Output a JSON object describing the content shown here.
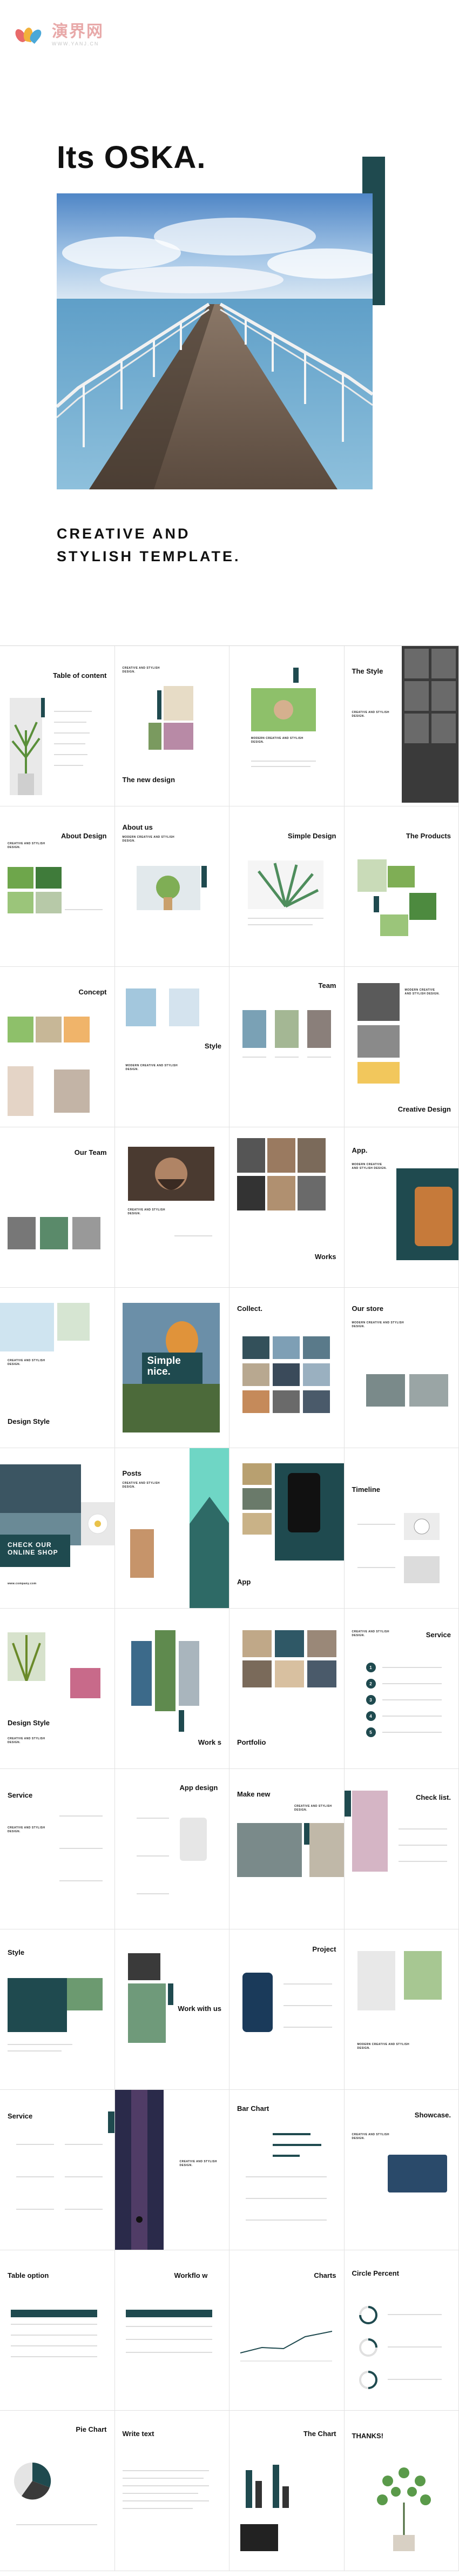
{
  "watermark": {
    "cn": "演界网",
    "en": "WWW.YANJ.CN"
  },
  "cover": {
    "title": "Its OSKA.",
    "subtitle_line1": "CREATIVE AND",
    "subtitle_line2": "STYLISH TEMPLATE."
  },
  "colors": {
    "accent": "#1f4a4f",
    "watermark": "#e8a9a9"
  },
  "slides": [
    {
      "title": "Table of content",
      "align": "right"
    },
    {
      "title": "The new design",
      "align": "left-bottom"
    },
    {
      "title": "",
      "align": "left"
    },
    {
      "title": "The Style",
      "align": "left"
    },
    {
      "title": "About Design",
      "align": "right"
    },
    {
      "title": "About us",
      "align": "left"
    },
    {
      "title": "Simple Design",
      "align": "right"
    },
    {
      "title": "The Products",
      "align": "right"
    },
    {
      "title": "Concept",
      "align": "right"
    },
    {
      "title": "Style",
      "align": "right"
    },
    {
      "title": "Team",
      "align": "right"
    },
    {
      "title": "Creative Design",
      "align": "right-bottom"
    },
    {
      "title": "Our Team",
      "align": "right"
    },
    {
      "title": "",
      "align": "left"
    },
    {
      "title": "Works",
      "align": "right-bottom"
    },
    {
      "title": "App.",
      "align": "left"
    },
    {
      "title": "Design Style",
      "align": "left-bottom"
    },
    {
      "title": "Simple nice.",
      "align": "center"
    },
    {
      "title": "Collect.",
      "align": "left"
    },
    {
      "title": "Our store",
      "align": "left"
    },
    {
      "title": "CHECK OUR ONLINE SHOP",
      "align": "left-bottom"
    },
    {
      "title": "Posts",
      "align": "left"
    },
    {
      "title": "App",
      "align": "left-bottom"
    },
    {
      "title": "Timeline",
      "align": "left"
    },
    {
      "title": "Design Style",
      "align": "left-bottom"
    },
    {
      "title": "Work s",
      "align": "right-bottom"
    },
    {
      "title": "Portfolio",
      "align": "left-bottom"
    },
    {
      "title": "Service",
      "align": "right"
    },
    {
      "title": "Service",
      "align": "left"
    },
    {
      "title": "App design",
      "align": "left"
    },
    {
      "title": "Make new",
      "align": "left"
    },
    {
      "title": "Check list.",
      "align": "right"
    },
    {
      "title": "Style",
      "align": "left"
    },
    {
      "title": "Work with us",
      "align": "right"
    },
    {
      "title": "Project",
      "align": "right"
    },
    {
      "title": "",
      "align": "left"
    },
    {
      "title": "Service",
      "align": "left"
    },
    {
      "title": "",
      "align": "left"
    },
    {
      "title": "Bar Chart",
      "align": "left"
    },
    {
      "title": "Showcase.",
      "align": "right"
    },
    {
      "title": "Table option",
      "align": "left"
    },
    {
      "title": "Workflo w",
      "align": "left"
    },
    {
      "title": "Charts",
      "align": "right"
    },
    {
      "title": "Circle Percent",
      "align": "left"
    },
    {
      "title": "Pie Chart",
      "align": "right"
    },
    {
      "title": "Write text",
      "align": "left"
    },
    {
      "title": "The Chart",
      "align": "right"
    },
    {
      "title": "THANKS!",
      "align": "left"
    }
  ],
  "captions": {
    "creative": "CREATIVE AND STYLISH DESIGN.",
    "modern": "MODERN CREATIVE AND STYLISH DESIGN.",
    "simple_nice": "Simple nice.",
    "check_shop": "CHECK OUR ONLINE SHOP",
    "site": "www.company.com"
  }
}
